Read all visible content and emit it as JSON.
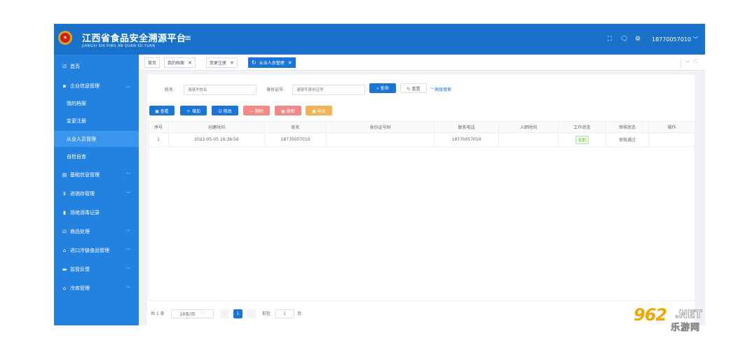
{
  "header": {
    "title": "江西省食品安全溯源平台",
    "subtitle": "JIANGXI SHI PING AN QUAN SU YUAN",
    "emblem_glyph": "★",
    "menu_icon": "≡",
    "icons": {
      "fullscreen": "⛶",
      "chat": "🗨",
      "settings": "⚙"
    },
    "user": "18770057010 ﹀"
  },
  "sidebar": {
    "items": [
      {
        "label": "首页",
        "icon": "edit-icon",
        "glyph": "☑",
        "has_chevron": false
      },
      {
        "label": "企业信息管理",
        "icon": "folder-icon",
        "glyph": "▪",
        "has_chevron": true,
        "chevron": "︿"
      },
      {
        "label": "我的档案",
        "sub": true
      },
      {
        "label": "变更注册",
        "sub": true
      },
      {
        "label": "从业人员管理",
        "sub": true,
        "active": true
      },
      {
        "label": "自检自查",
        "sub": true
      },
      {
        "label": "基础信息管理",
        "icon": "clipboard-icon",
        "glyph": "▤",
        "has_chevron": true,
        "chevron": "﹀"
      },
      {
        "label": "进销存管理",
        "icon": "cart-icon",
        "glyph": "⊻",
        "has_chevron": true,
        "chevron": "﹀"
      },
      {
        "label": "场地消毒记录",
        "icon": "bar-chart-icon",
        "glyph": "▮",
        "has_chevron": false
      },
      {
        "label": "商品处理",
        "icon": "edit-icon",
        "glyph": "☑",
        "has_chevron": true,
        "chevron": "﹀"
      },
      {
        "label": "进口冷链食品管理",
        "icon": "home-icon",
        "glyph": "⌂",
        "has_chevron": true,
        "chevron": "﹀"
      },
      {
        "label": "监管反馈",
        "icon": "monitor-icon",
        "glyph": "▬",
        "has_chevron": true,
        "chevron": "﹀"
      },
      {
        "label": "冷库管理",
        "icon": "home-icon",
        "glyph": "⌂",
        "has_chevron": true,
        "chevron": "﹀"
      }
    ]
  },
  "tabs": [
    {
      "label": "首页",
      "closable": false
    },
    {
      "label": "我的档案",
      "closable": true,
      "close": "✕"
    },
    {
      "label": "变更注册",
      "closable": true,
      "close": "✕"
    },
    {
      "label": "从业人员管理",
      "closable": true,
      "close": "✕",
      "active": true,
      "refresh": "↻"
    }
  ],
  "tabs_right": {
    "collapse": "﹀",
    "fullscreen": "⛶"
  },
  "search": {
    "name_label": "姓名:",
    "name_placeholder": "请填写姓名",
    "id_label": "身份证号:",
    "id_placeholder": "请填写身份证号",
    "search_button": "⌕ 查询",
    "reset_button": "↻ 重置",
    "advanced_link": "﹀高级搜索"
  },
  "toolbar": {
    "view": "▣ 查看",
    "add": "＋ 增加",
    "edit": "☑ 修改",
    "delete": "— 删除",
    "resign": "▣ 离职",
    "export": "▣ 导出"
  },
  "table": {
    "columns": [
      "序号",
      "创建时间",
      "姓名",
      "身份证号码",
      "联系电话",
      "入职时间",
      "工作状态",
      "审核状态",
      "操作"
    ],
    "rows": [
      {
        "index": "1",
        "created": "2022-05-05 16:36:56",
        "name": "18770057010",
        "id_number": "",
        "phone": "18770057010",
        "join_date": "",
        "work_status": "在职",
        "audit_status": "审核通过",
        "actions": ""
      }
    ]
  },
  "pagination": {
    "total": "共 1 条",
    "page_size": "20条/页",
    "size_chevron": "﹀",
    "prev": "‹",
    "current": "1",
    "next": "›",
    "goto_label": "前往",
    "goto_value": "1",
    "goto_suffix": "页"
  },
  "watermark": {
    "brand": "962",
    "tld": ".NET",
    "sub": "乐游网"
  },
  "colors": {
    "primary": "#1a75d6",
    "header": "#1971c9",
    "sidebar": "#2382e0",
    "danger": "#f38a8a",
    "warning": "#f0b45a",
    "success": "#67c23a"
  }
}
